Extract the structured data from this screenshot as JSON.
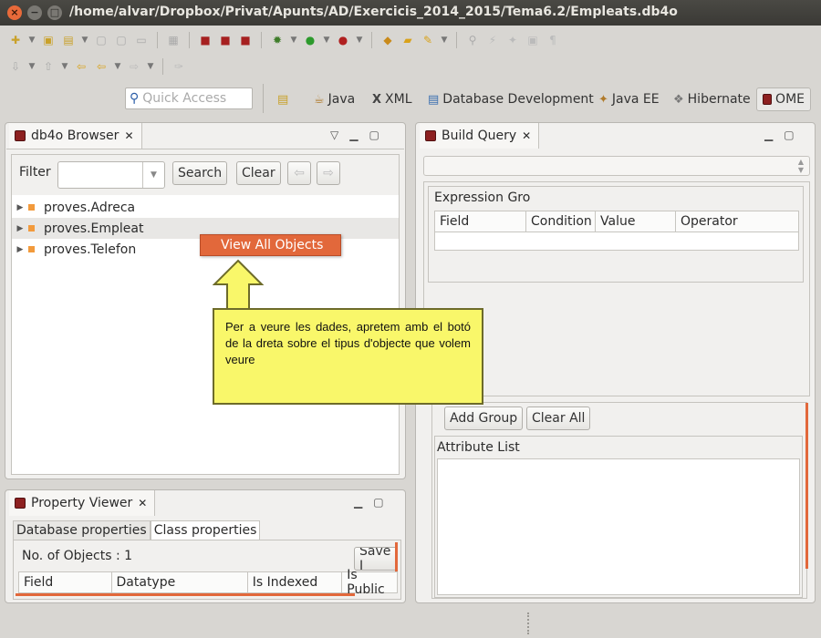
{
  "window": {
    "title": "/home/alvar/Dropbox/Privat/Apunts/AD/Exercicis_2014_2015/Tema6.2/Empleats.db4o"
  },
  "quick_access": {
    "placeholder": "Quick Access"
  },
  "perspectives": [
    {
      "label": "Java",
      "icon": "java-icon"
    },
    {
      "label": "XML",
      "icon": "xml-icon"
    },
    {
      "label": "Database Development",
      "icon": "database-icon"
    },
    {
      "label": "Java EE",
      "icon": "javaee-icon"
    },
    {
      "label": "Hibernate",
      "icon": "hibernate-icon"
    },
    {
      "label": "OME",
      "icon": "ome-icon"
    }
  ],
  "browser": {
    "tab_label": "db4o Browser",
    "filter_label": "Filter",
    "filter_value": "",
    "search_label": "Search",
    "clear_label": "Clear",
    "classes": [
      "proves.Adreca",
      "proves.Empleat",
      "proves.Telefon"
    ],
    "selected_index": 1
  },
  "context_menu": {
    "item": "View All Objects"
  },
  "callout": {
    "text": "Per a veure les dades, apretem amb el botó de la dreta sobre el tipus d'objecte que volem veure"
  },
  "build_query": {
    "tab_label": "Build Query",
    "expression_group_label": "Expression Gro",
    "columns": [
      "Field",
      "Condition",
      "Value",
      "Operator"
    ],
    "add_group_label": "Add Group",
    "clear_all_label": "Clear All",
    "attribute_list_label": "Attribute List"
  },
  "property_viewer": {
    "tab_label": "Property Viewer",
    "tabs": [
      "Database properties",
      "Class properties"
    ],
    "active_tab": 1,
    "no_objects": "No. of Objects : 1",
    "save_label": "Save I",
    "columns": [
      "Field",
      "Datatype",
      "Is Indexed",
      "Is Public"
    ]
  },
  "colors": {
    "accent": "#e2683b",
    "callout": "#f9f76a",
    "titlebar": "#3c3b37"
  }
}
